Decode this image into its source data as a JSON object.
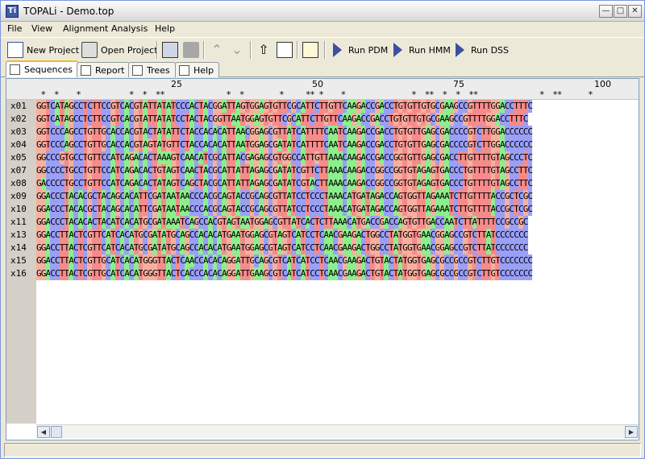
{
  "window": {
    "title": "TOPALi - Demo.top",
    "icon_text": "Ti"
  },
  "menu": [
    {
      "label": "File"
    },
    {
      "label": "View"
    },
    {
      "label": "Alignment"
    },
    {
      "label": "Analysis"
    },
    {
      "label": "Help"
    }
  ],
  "toolbar": {
    "new_project": "New Project",
    "open_project": "Open Project",
    "run_pdm": "Run PDM",
    "run_hmm": "Run HMM",
    "run_dss": "Run DSS"
  },
  "tabs": [
    {
      "label": "Sequences",
      "active": true
    },
    {
      "label": "Report",
      "active": false
    },
    {
      "label": "Trees",
      "active": false
    },
    {
      "label": "Help",
      "active": false
    }
  ],
  "ruler": {
    "ticks": [
      "25",
      "50",
      "75",
      "100"
    ],
    "stars": " *  *    *           *  *  **              *  *        *     ** *    *               *  **  *  *  **              *  **      *"
  },
  "sequences": [
    {
      "name": "x01",
      "seq": "GGTCATAGCCTCTTCCGTCACGTATTATATCCCACTACGGATTAGTGGAGTGTTCGCATTCTTGTTCAAGACCGACCTGTGTTGTGCGAAGCCGTTTTGGACCTTTC"
    },
    {
      "name": "x02",
      "seq": "GGTCATAGCCTCTTCCGTCACGTATTATATCCTACTACGGTTAATGGAGTGTTCGCATTCTTGTTCAAGACCGACCTGTGTTGTGCGAAGCCGTTTTGGACCTTTC"
    },
    {
      "name": "x03",
      "seq": "GGTCCCAGCCTGTTGCACCACGTACTATATTCTACCACACATTAACGGAGCGTTATCATTTTCAATCAAGACCGACCTGTGTTGAGCGACCCCGTCTTGGACCCCCC"
    },
    {
      "name": "x04",
      "seq": "GGTCCCAGCCTGTTGCACCACGTAGTATGTTCTACCACACATTAATGGAGCGATATCATTTTCAATCAAGACCGACCTGTGTTGAGCGACCCCGTCTTGGACCCCCC"
    },
    {
      "name": "x05",
      "seq": "GGCCCGTGCCTGTTCCATCAGACACTAAAGTCAACATCGCATTACGAGAGCGTGGCCATTGTTAAACAAGACCGACCGGTGTTGAGCGACCTTGTTTTGTAGCCCTC"
    },
    {
      "name": "x07",
      "seq": "GGCCCCTGCCTGTTCCATCAGACACTGTAGTCAACTACGCATTATTAGAGCGATATCGTTCTTAAACAAGACCGGCCGGTGTAGAGTGACCCTGTTTTGTAGCCTTC"
    },
    {
      "name": "x08",
      "seq": "GACCCCTGCCTGTTCCATCAGACACTATAGTCAGCTACGCATTATTAGAGCGATATCGTACTTAAACAAGACCGGCCGGTGTAGAGTGACCCTGTTTTGTAGCCTTC"
    },
    {
      "name": "x09",
      "seq": "GGACCCTACACGCTACAGCACATTCGATAATAACCCACGCAGTACCGCAGCGTTATCCTCCCTAAACATGATAGACCAGTGGTTAGAAATCTTGTTTTACCGCTCGC"
    },
    {
      "name": "x10",
      "seq": "GGACCCTACACGCTACAGCACATTCGATAATAACCCACGCAGTACCGCAGCGTTATCCTCCCTAAACATGATAGACCAGTGGTTAGAAATCTTGTTTTACCGCTCGC"
    },
    {
      "name": "x11",
      "seq": "GGACCCTACACACTACATCACATGCGATAAATCAGCCACGTAGTAATGGAGCGTTATCACTCTTAAACATGACCGACCAGTGTTGACCAATCTTATTTTCCGCCGC"
    },
    {
      "name": "x13",
      "seq": "GGACCTTACTCGTTCATCACATGCGATATGCAGCCACACATGAATGGAGCGTAGTCATCCTCAACGAAGACTGGCCTATGGTGAACGGAGCCGTCTTATCCCCCCC"
    },
    {
      "name": "x14",
      "seq": "GGACCTTACTCGTTCATCACATGCGATATGCAGCCACACATGAATGGAGCGTAGTCATCCTCAACGAAGACTGGCCTATGGTGAACGGAGCCGTCTTATCCCCCCC"
    },
    {
      "name": "x15",
      "seq": "GGACCTTACTCGTTGCATCACATGGGTTACTCAACCACACAGGATTGCAGCGTCATCATCCTCAACGAAGACTGTACTATGGTGAGCGCCGCCGTCTTGTCCCCCCC"
    },
    {
      "name": "x16",
      "seq": "GGACCTTACTCGTTGCATCACATGGGTTACTCACCCACACAGGATTGAAGCGTCATCATCCTCAACGAAGACTGTACTATGGTGAGCGCCGCCGTCTTGTCCCCCCC"
    }
  ],
  "colors": {
    "A": "#8bf08b",
    "C": "#9a9ff8",
    "G": "#f7b09e",
    "T": "#f78b8b",
    "accent": "#f7b733"
  }
}
